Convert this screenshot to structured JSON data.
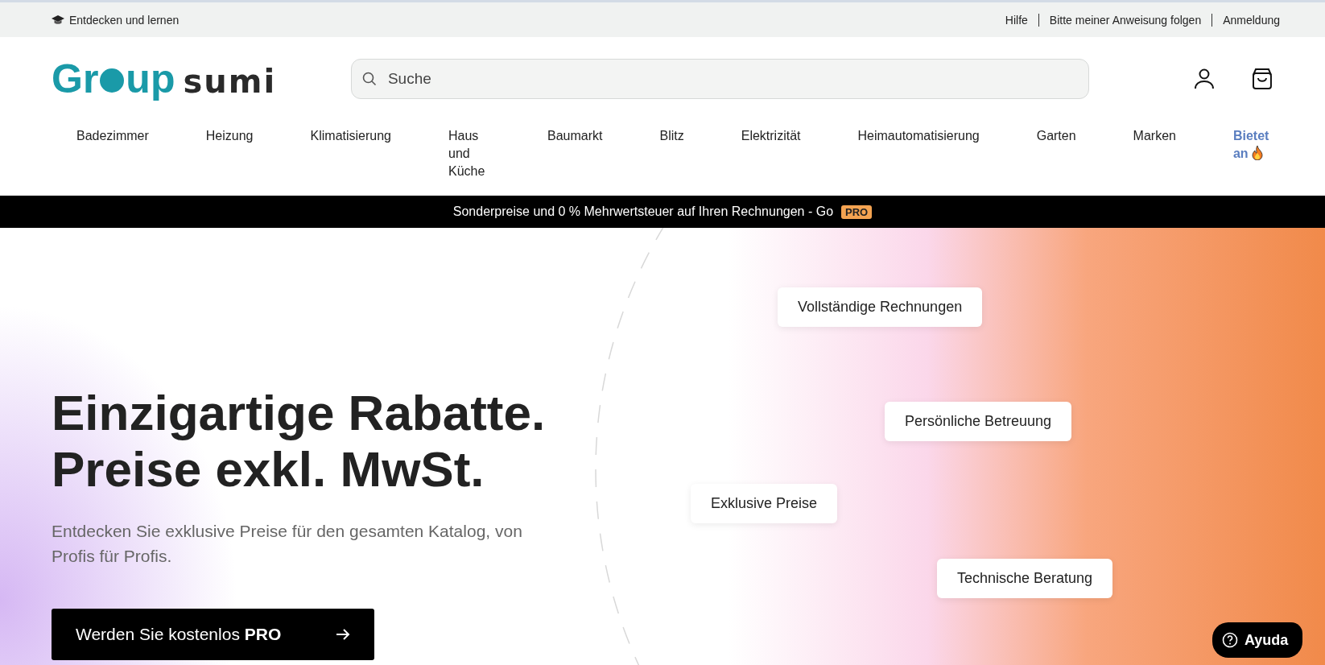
{
  "top_bar": {
    "left_link": "Entdecken und lernen",
    "links": [
      "Hilfe",
      "Bitte meiner Anweisung folgen",
      "Anmeldung"
    ]
  },
  "header": {
    "logo": {
      "part_1": "Gr",
      "part_2": "up",
      "part_3": "sumi"
    },
    "search": {
      "placeholder": "Suche"
    }
  },
  "nav": [
    {
      "label": "Badezimmer",
      "kind": "normal"
    },
    {
      "label": "Heizung",
      "kind": "normal"
    },
    {
      "label": "Klimatisierung",
      "kind": "normal"
    },
    {
      "label": "Haus und Küche",
      "kind": "normal"
    },
    {
      "label": "Baumarkt",
      "kind": "normal"
    },
    {
      "label": "Blitz",
      "kind": "normal"
    },
    {
      "label": "Elektrizität",
      "kind": "normal"
    },
    {
      "label": "Heimautomatisierung",
      "kind": "normal"
    },
    {
      "label": "Garten",
      "kind": "normal"
    },
    {
      "label": "Marken",
      "kind": "normal"
    },
    {
      "label": "Bietet an",
      "kind": "offer"
    }
  ],
  "promo_banner": {
    "text": "Sonderpreise und 0 % Mehrwertsteuer auf Ihren Rechnungen - Go",
    "badge": "PRO"
  },
  "hero": {
    "title_lines": [
      "Einzigartige Rabatte.",
      "Preise exkl. MwSt."
    ],
    "subtitle": "Entdecken Sie exklusive Preise für den gesamten Katalog, von Profis für Profis.",
    "cta": {
      "label": "Werden Sie kostenlos",
      "emphasis": "PRO"
    },
    "features": [
      "Vollständige Rechnungen",
      "Persönliche Betreuung",
      "Exklusive Preise",
      "Technische Beratung"
    ]
  },
  "help_button": "Ayuda"
}
